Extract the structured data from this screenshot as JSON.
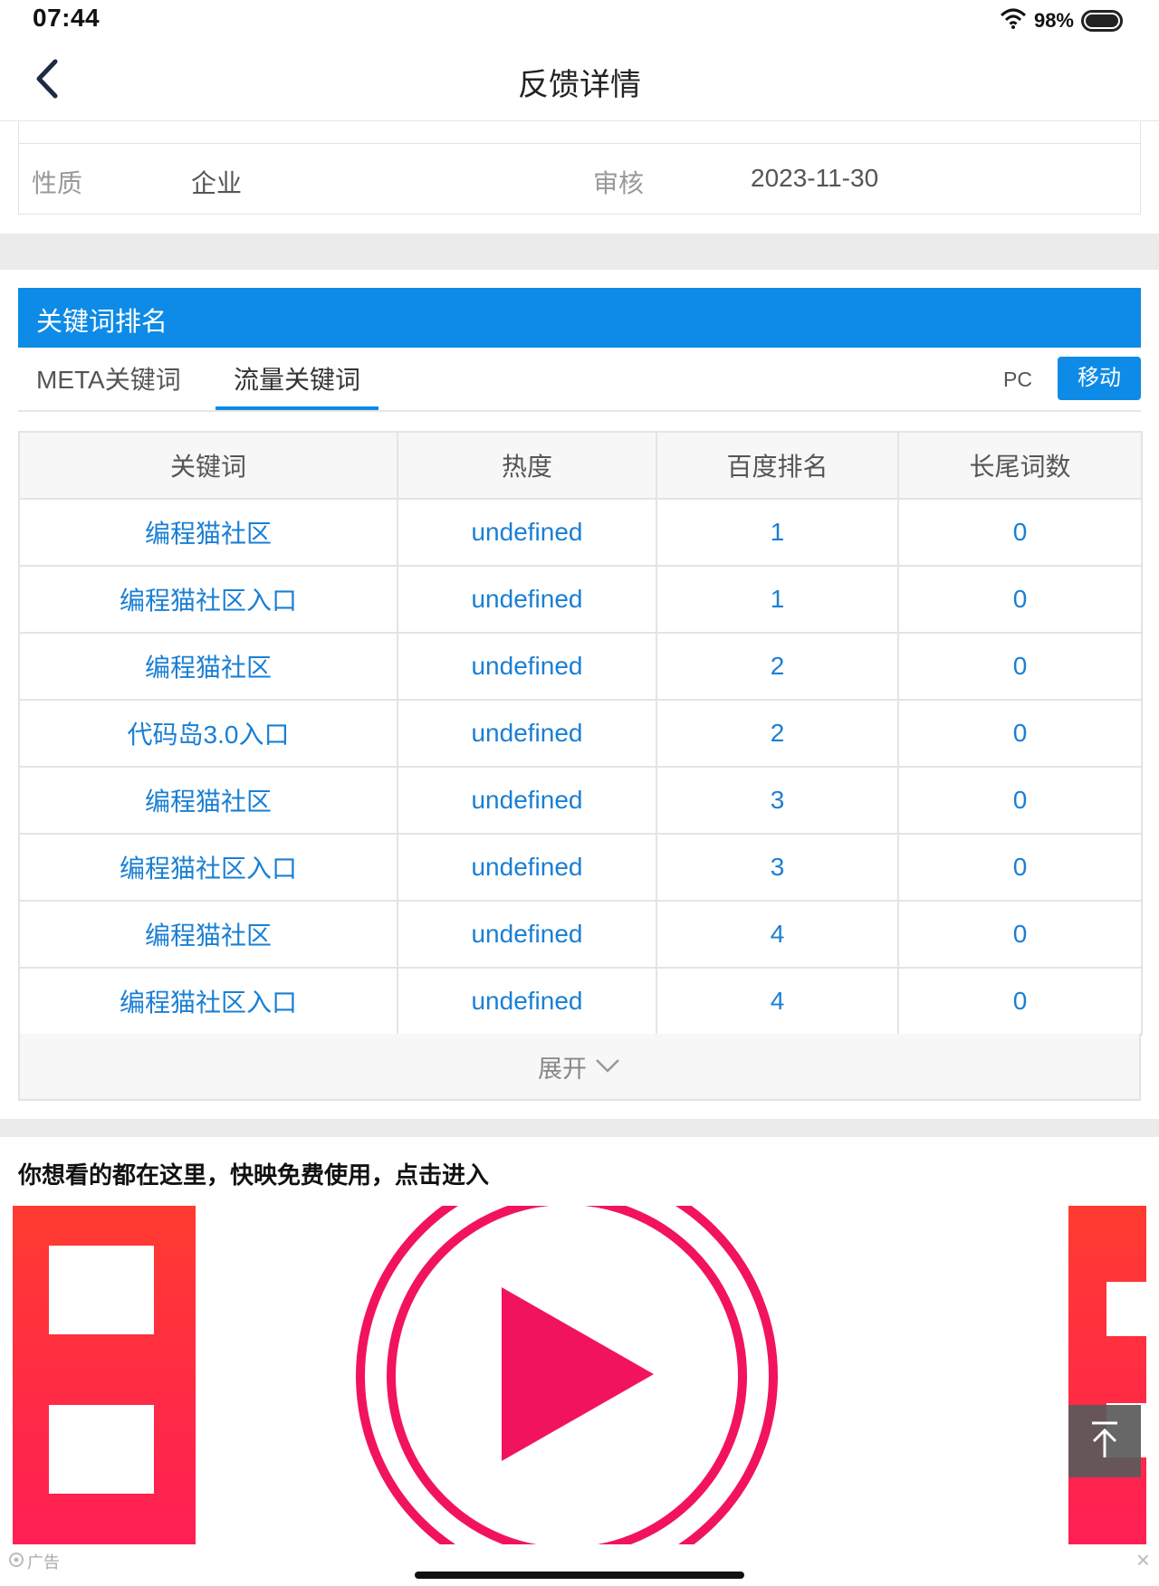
{
  "status_bar": {
    "time": "07:44",
    "battery": "98%"
  },
  "nav": {
    "title": "反馈详情"
  },
  "info": {
    "label1": "性质",
    "value1": "企业",
    "label2": "审核",
    "value2": "2023-11-30"
  },
  "keywords": {
    "section_title": "关键词排名",
    "tabs": [
      "META关键词",
      "流量关键词"
    ],
    "active_tab": "流量关键词",
    "device_pc": "PC",
    "device_mobile": "移动",
    "columns": [
      "关键词",
      "热度",
      "百度排名",
      "长尾词数"
    ],
    "rows": [
      [
        "编程猫社区",
        "undefined",
        "1",
        "0"
      ],
      [
        "编程猫社区入口",
        "undefined",
        "1",
        "0"
      ],
      [
        "编程猫社区",
        "undefined",
        "2",
        "0"
      ],
      [
        "代码岛3.0入口",
        "undefined",
        "2",
        "0"
      ],
      [
        "编程猫社区",
        "undefined",
        "3",
        "0"
      ],
      [
        "编程猫社区入口",
        "undefined",
        "3",
        "0"
      ],
      [
        "编程猫社区",
        "undefined",
        "4",
        "0"
      ],
      [
        "编程猫社区入口",
        "undefined",
        "4",
        "0"
      ]
    ],
    "expand_label": "展开"
  },
  "ad": {
    "title": "你想看的都在这里，快映免费使用，点击进入",
    "label": "广告",
    "close": "×"
  },
  "colors": {
    "accent": "#0d8be6",
    "link": "#1a7fd4",
    "ad_red": "#ff2d45",
    "ad_pink": "#f2135e"
  },
  "icons": [
    "back-chevron-icon",
    "wifi-icon",
    "battery-icon",
    "chevron-down-icon",
    "back-to-top-icon",
    "ad-logo-icon",
    "close-icon"
  ]
}
